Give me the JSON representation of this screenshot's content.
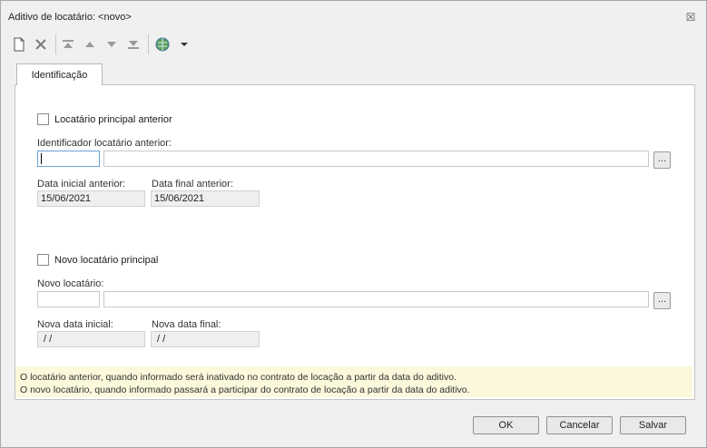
{
  "window": {
    "title": "Aditivo de locatário: <novo>"
  },
  "toolbar": {
    "icons": [
      "new-document-icon",
      "delete-icon",
      "first-record-icon",
      "previous-record-icon",
      "next-record-icon",
      "last-record-icon",
      "globe-icon",
      "dropdown-arrow-icon"
    ]
  },
  "tabs": [
    {
      "label": "Identificação"
    }
  ],
  "section_previous": {
    "checkbox_label": "Locatário principal anterior",
    "checked": false,
    "identifier_label": "Identificador locatário anterior:",
    "identifier_code": "",
    "identifier_name": "",
    "lookup_label": "...",
    "start_date_label": "Data inicial anterior:",
    "start_date": "15/06/2021",
    "end_date_label": "Data final anterior:",
    "end_date": "15/06/2021"
  },
  "section_new": {
    "checkbox_label": "Novo locatário principal",
    "checked": false,
    "tenant_label": "Novo locatário:",
    "tenant_code": "",
    "tenant_name": "",
    "lookup_label": "...",
    "start_date_label": "Nova data inicial:",
    "start_date": " / /",
    "end_date_label": "Nova data final:",
    "end_date": " / /"
  },
  "info": {
    "line1": "O locatário anterior, quando informado será inativado no contrato de locação a partir da data do aditivo.",
    "line2": "O novo locatário, quando informado passará a participar do contrato de locação a partir da data do aditivo."
  },
  "buttons": {
    "ok": "OK",
    "cancel": "Cancelar",
    "save": "Salvar"
  },
  "colors": {
    "window_bg": "#f0f0f0",
    "panel_bg": "#ffffff",
    "info_bg": "#fbf8dc",
    "focus_border": "#6aa2d9",
    "readonly_bg": "#efefef"
  }
}
